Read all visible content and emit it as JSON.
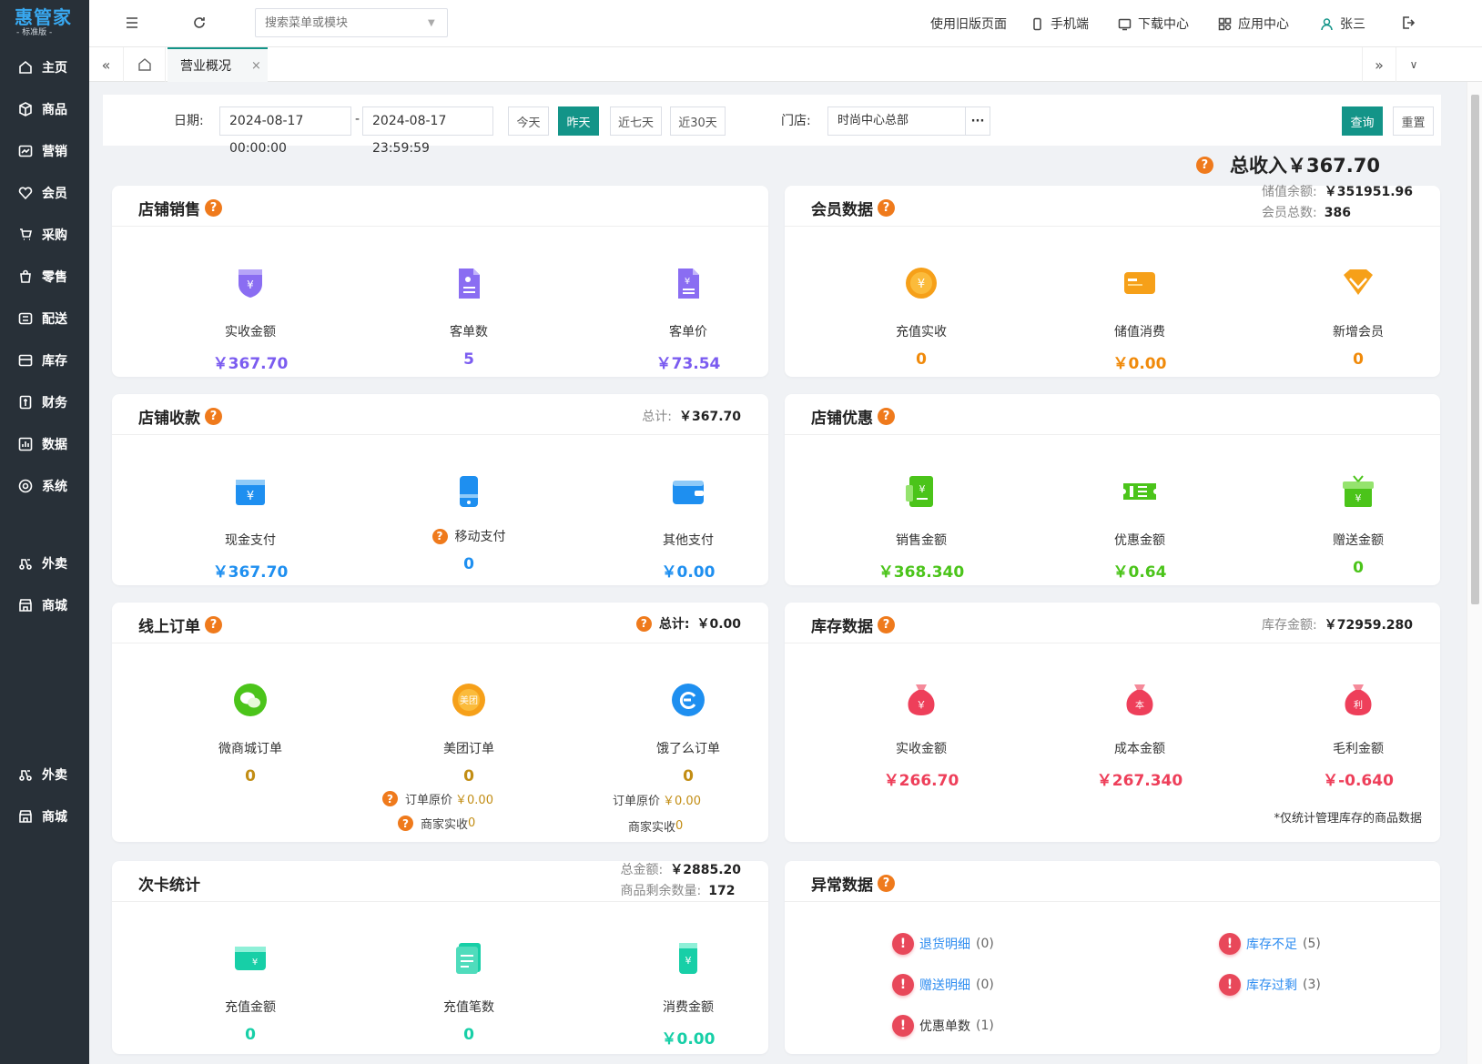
{
  "brand": {
    "name": "惠管家",
    "edition": "- 标准版 -"
  },
  "sidebar": {
    "items": [
      {
        "label": "主页",
        "icon": "home-icon"
      },
      {
        "label": "商品",
        "icon": "box-icon"
      },
      {
        "label": "营销",
        "icon": "chart-icon"
      },
      {
        "label": "会员",
        "icon": "heart-icon"
      },
      {
        "label": "采购",
        "icon": "cart-icon"
      },
      {
        "label": "零售",
        "icon": "bag-icon"
      },
      {
        "label": "配送",
        "icon": "truck-icon"
      },
      {
        "label": "库存",
        "icon": "warehouse-icon"
      },
      {
        "label": "财务",
        "icon": "finance-icon"
      },
      {
        "label": "数据",
        "icon": "data-icon"
      },
      {
        "label": "系统",
        "icon": "settings-icon"
      },
      {
        "label": "外卖",
        "icon": "delivery-icon"
      },
      {
        "label": "商城",
        "icon": "store-icon"
      },
      {
        "label": "外卖",
        "icon": "delivery-icon"
      },
      {
        "label": "商城",
        "icon": "store-icon"
      }
    ]
  },
  "topbar": {
    "search_placeholder": "搜索菜单或模块",
    "old_version": "使用旧版页面",
    "mobile": "手机端",
    "download": "下载中心",
    "apps": "应用中心",
    "user": "张三"
  },
  "tabs": {
    "active": "营业概况",
    "close": "×"
  },
  "filters": {
    "date_label": "日期:",
    "start": "2024-08-17 00:00:00",
    "sep": "-",
    "end": "2024-08-17 23:59:59",
    "quick": [
      "今天",
      "昨天",
      "近七天",
      "近30天"
    ],
    "store_label": "门店:",
    "store_value": "时尚中心总部",
    "store_more": "···",
    "query": "查询",
    "reset": "重置"
  },
  "total_income": {
    "label": "总收入",
    "value": "￥367.70"
  },
  "cards": {
    "store_sales": {
      "title": "店铺销售",
      "metrics": [
        {
          "label": "实收金额",
          "value": "￥367.70"
        },
        {
          "label": "客单数",
          "value": "5"
        },
        {
          "label": "客单价",
          "value": "￥73.54"
        }
      ]
    },
    "member": {
      "title": "会员数据",
      "meta": [
        {
          "label": "储值余额:",
          "value": "￥351951.96"
        },
        {
          "label": "会员总数:",
          "value": "386"
        }
      ],
      "metrics": [
        {
          "label": "充值实收",
          "value": "0"
        },
        {
          "label": "储值消费",
          "value": "￥0.00"
        },
        {
          "label": "新增会员",
          "value": "0"
        }
      ]
    },
    "collection": {
      "title": "店铺收款",
      "meta_label": "总计:",
      "meta_value": "￥367.70",
      "metrics": [
        {
          "label": "现金支付",
          "value": "￥367.70"
        },
        {
          "label": "移动支付",
          "value": "0"
        },
        {
          "label": "其他支付",
          "value": "￥0.00"
        }
      ]
    },
    "discount": {
      "title": "店铺优惠",
      "metrics": [
        {
          "label": "销售金额",
          "value": "￥368.340"
        },
        {
          "label": "优惠金额",
          "value": "￥0.64"
        },
        {
          "label": "赠送金额",
          "value": "0"
        }
      ]
    },
    "online": {
      "title": "线上订单",
      "meta_label": "总计:",
      "meta_value": "￥0.00",
      "metrics": [
        {
          "label": "微商城订单",
          "value": "0"
        },
        {
          "label": "美团订单",
          "value": "0"
        },
        {
          "label": "饿了么订单",
          "value": "0"
        }
      ],
      "notes": {
        "orig_label": "订单原价",
        "orig_value": "￥0.00",
        "actual_label": "商家实收",
        "actual_value": "0"
      }
    },
    "inventory": {
      "title": "库存数据",
      "meta_label": "库存金额:",
      "meta_value": "￥72959.280",
      "metrics": [
        {
          "label": "实收金额",
          "value": "￥266.70",
          "glyph": "￥"
        },
        {
          "label": "成本金额",
          "value": "￥267.340",
          "glyph": "本"
        },
        {
          "label": "毛利金额",
          "value": "￥-0.640",
          "glyph": "利"
        }
      ],
      "footnote": "*仅统计管理库存的商品数据"
    },
    "card_stats": {
      "title": "次卡统计",
      "meta": [
        {
          "label": "总金额:",
          "value": "￥2885.20"
        },
        {
          "label": "商品剩余数量:",
          "value": "172"
        }
      ],
      "metrics": [
        {
          "label": "充值金额",
          "value": "0"
        },
        {
          "label": "充值笔数",
          "value": "0"
        },
        {
          "label": "消费金额",
          "value": "￥0.00"
        }
      ]
    },
    "abnormal": {
      "title": "异常数据",
      "items": [
        {
          "label": "退货明细",
          "count": "(0)"
        },
        {
          "label": "库存不足",
          "count": "(5)"
        },
        {
          "label": "赠送明细",
          "count": "(0)"
        },
        {
          "label": "库存过剩",
          "count": "(3)"
        },
        {
          "label": "优惠单数",
          "count": "(1)"
        }
      ]
    }
  },
  "colors": {
    "primary": "#139488",
    "sales": "#7b5cf0",
    "member": "#f08a0a",
    "payment": "#1e8ff0",
    "discount": "#4bc41a",
    "online": "#c28d14",
    "inventory": "#ee3f5a",
    "cards": "#17cfa7",
    "alert": "#e8485a"
  }
}
